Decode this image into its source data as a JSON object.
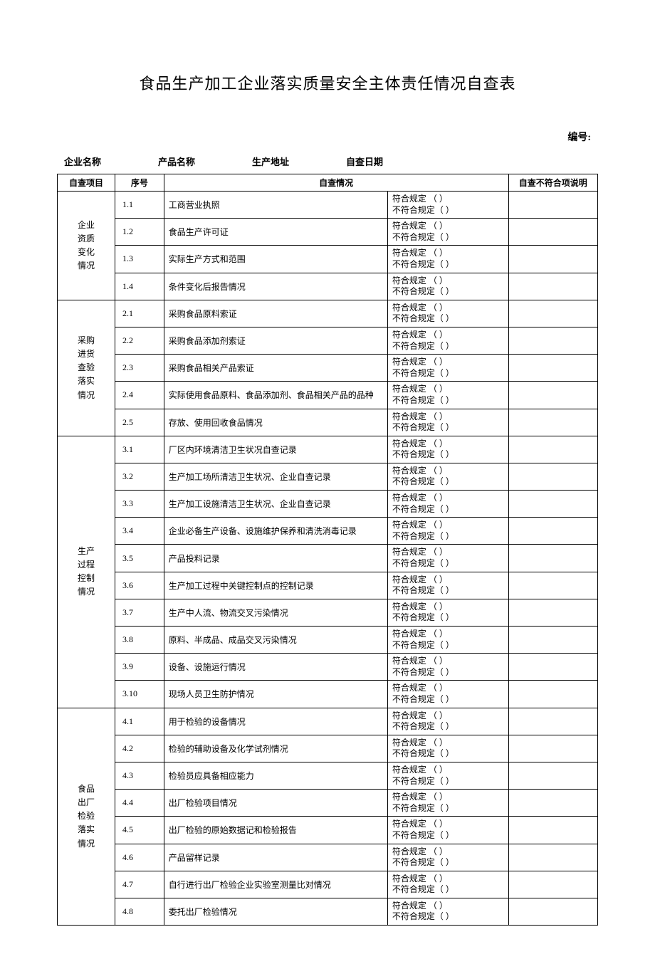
{
  "title": "食品生产加工企业落实质量安全主体责任情况自查表",
  "numbering_label": "编号:",
  "info": {
    "company_label": "企业名称",
    "product_label": "产品名称",
    "address_label": "生产地址",
    "date_label": "自查日期"
  },
  "headers": {
    "project": "自查项目",
    "num": "序号",
    "situation": "自查情况",
    "remark": "自查不符合项说明"
  },
  "status_conform": "符合规定 （   ）",
  "status_nonconform": "不符合规定（   ）",
  "sections": [
    {
      "name_lines": [
        "企业",
        "资质",
        "变化",
        "情况"
      ],
      "rows": [
        {
          "num": "1.1",
          "desc": "工商营业执照"
        },
        {
          "num": "1.2",
          "desc": "食品生产许可证"
        },
        {
          "num": "1.3",
          "desc": "实际生产方式和范围"
        },
        {
          "num": "1.4",
          "desc": "条件变化后报告情况"
        }
      ]
    },
    {
      "name_lines": [
        "采购",
        "进货",
        "查验",
        "落实",
        "情况"
      ],
      "rows": [
        {
          "num": "2.1",
          "desc": "采购食品原料索证"
        },
        {
          "num": "2.2",
          "desc": "采购食品添加剂索证"
        },
        {
          "num": "2.3",
          "desc": "采购食品相关产品索证"
        },
        {
          "num": "2.4",
          "desc": "实际使用食品原料、食品添加剂、食品相关产品的品种"
        },
        {
          "num": "2.5",
          "desc": "存放、使用回收食品情况"
        }
      ]
    },
    {
      "name_lines": [
        "生产",
        "过程",
        "控制",
        "情况"
      ],
      "rows": [
        {
          "num": "3.1",
          "desc": "厂区内环境清洁卫生状况自查记录"
        },
        {
          "num": "3.2",
          "desc": "生产加工场所清洁卫生状况、企业自查记录"
        },
        {
          "num": "3.3",
          "desc": "生产加工设施清洁卫生状况、企业自查记录"
        },
        {
          "num": "3.4",
          "desc": "企业必备生产设备、设施维护保养和清洗消毒记录"
        },
        {
          "num": "3.5",
          "desc": "产品投料记录"
        },
        {
          "num": "3.6",
          "desc": "生产加工过程中关键控制点的控制记录"
        },
        {
          "num": "3.7",
          "desc": "生产中人流、物流交叉污染情况"
        },
        {
          "num": "3.8",
          "desc": "原料、半成品、成品交叉污染情况"
        },
        {
          "num": "3.9",
          "desc": "设备、设施运行情况"
        },
        {
          "num": "3.10",
          "desc": "现场人员卫生防护情况"
        }
      ]
    },
    {
      "name_lines": [
        "食品",
        "出厂",
        "检验",
        "落实",
        "情况"
      ],
      "rows": [
        {
          "num": "4.1",
          "desc": "用于检验的设备情况"
        },
        {
          "num": "4.2",
          "desc": "检验的辅助设备及化学试剂情况"
        },
        {
          "num": "4.3",
          "desc": "检验员应具备相应能力"
        },
        {
          "num": "4.4",
          "desc": "出厂检验项目情况"
        },
        {
          "num": "4.5",
          "desc": "出厂检验的原始数据记和检验报告"
        },
        {
          "num": "4.6",
          "desc": "产品留样记录"
        },
        {
          "num": "4.7",
          "desc": "自行进行出厂检验企业实验室测量比对情况"
        },
        {
          "num": "4.8",
          "desc": "委托出厂检验情况"
        }
      ]
    }
  ]
}
